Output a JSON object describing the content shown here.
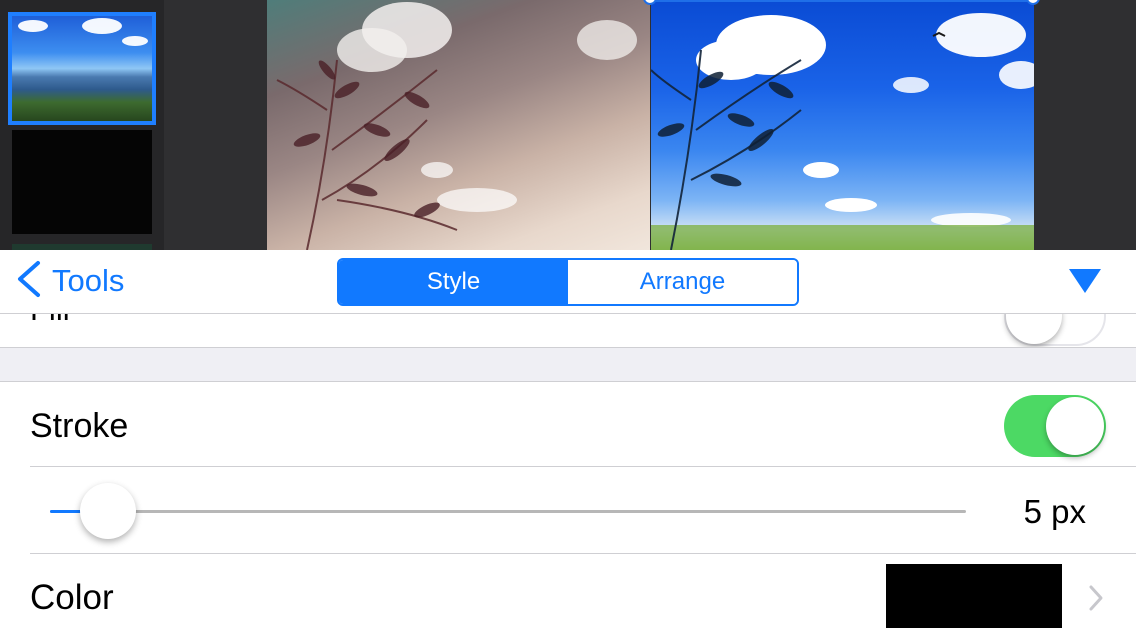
{
  "toolbar": {
    "back_label": "Tools",
    "tabs": [
      {
        "label": "Style",
        "active": true
      },
      {
        "label": "Arrange",
        "active": false
      }
    ]
  },
  "settings": {
    "fill": {
      "label": "Fill",
      "enabled": false
    },
    "stroke": {
      "label": "Stroke",
      "enabled": true
    },
    "stroke_width": {
      "value": 5,
      "display": "5 px"
    },
    "color": {
      "label": "Color",
      "value": "#000000"
    }
  },
  "colors": {
    "accent": "#1179ff",
    "toggle_on": "#4cd964"
  },
  "icons": [
    "chevron-left-icon",
    "triangle-down-icon",
    "chevron-right-icon"
  ]
}
